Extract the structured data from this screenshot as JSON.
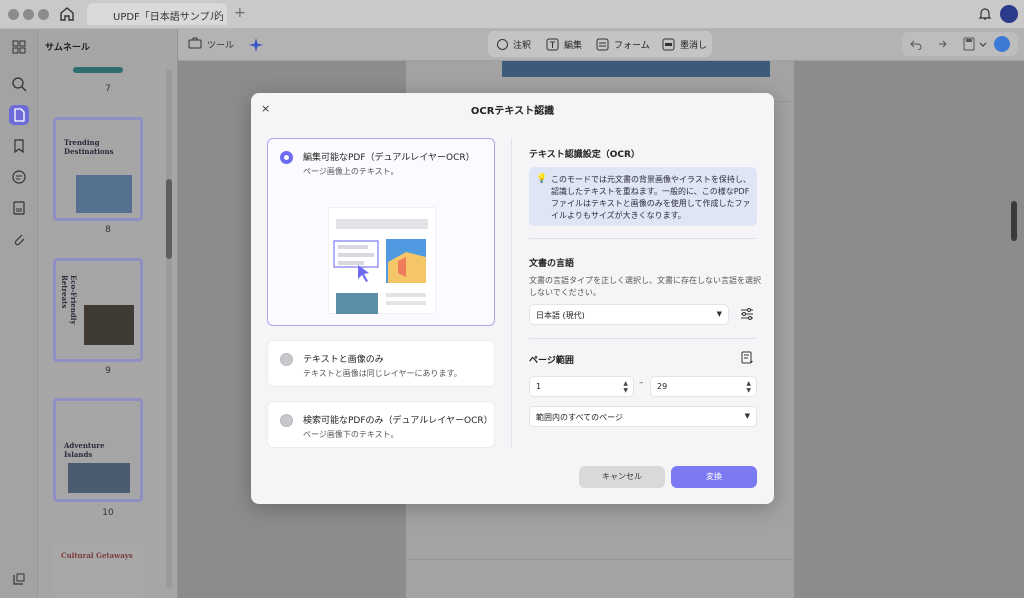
{
  "window": {
    "tab_title": "UPDF「日本語サンプル」",
    "tab_close": "×",
    "tab_add": "+"
  },
  "icons": {
    "home": "home-icon",
    "bell": "bell-icon",
    "avatar": "user-avatar-icon"
  },
  "sidebar": {
    "title": "サムネール",
    "thumbnails": [
      {
        "page": "7"
      },
      {
        "page": "8",
        "title": "Trending Destinations"
      },
      {
        "page": "9",
        "title": "Eco-Friendly Retreats"
      },
      {
        "page": "10",
        "title": "Adventure Islands"
      },
      {
        "page": "",
        "title": "Cultural Getaways"
      }
    ]
  },
  "toolbar": {
    "tools_label": "ツール",
    "annotate": "注釈",
    "edit": "編集",
    "form": "フォーム",
    "redact": "墨消し"
  },
  "modal": {
    "title": "OCRテキスト認識",
    "close": "×",
    "options": [
      {
        "title": "編集可能なPDF（デュアルレイヤーOCR）",
        "desc": "ページ画像上のテキスト。",
        "selected": true
      },
      {
        "title": "テキストと画像のみ",
        "desc": "テキストと画像は同じレイヤーにあります。",
        "selected": false
      },
      {
        "title": "検索可能なPDFのみ（デュアルレイヤーOCR）",
        "desc": "ページ画像下のテキスト。",
        "selected": false
      }
    ],
    "settings_label": "テキスト認識設定（OCR）",
    "info_text": "このモードでは元文書の背景画像やイラストを保持し、認識したテキストを重ねます。一般的に、この様なPDFファイルはテキストと画像のみを使用して作成したファイルよりもサイズが大きくなります。",
    "language_label": "文書の言語",
    "language_desc": "文書の言語タイプを正しく選択し、文書に存在しない言語を選択しないでください。",
    "language_value": "日本語 (現代)",
    "range_label": "ページ範囲",
    "range_from": "1",
    "range_dash": "–",
    "range_to": "29",
    "range_mode": "範囲内のすべてのページ",
    "cancel": "キャンセル",
    "convert": "変換"
  },
  "colors": {
    "accent": "#6d6bf0",
    "info_bg": "#dfe5f5",
    "primary_button": "#7b7af3"
  }
}
